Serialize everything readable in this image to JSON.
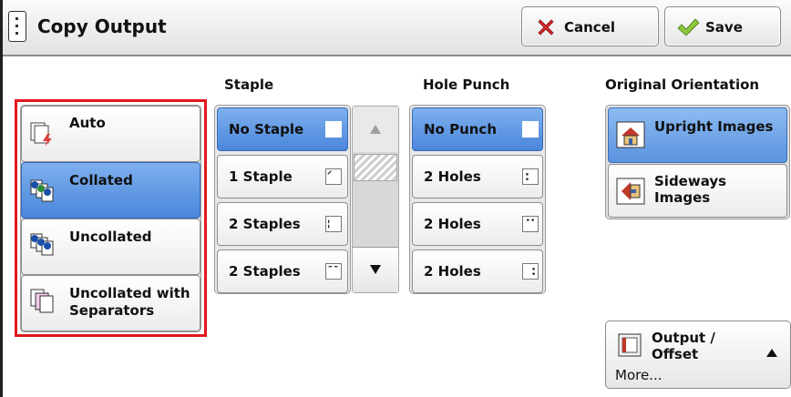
{
  "header": {
    "title": "Copy Output",
    "cancel_label": "Cancel",
    "save_label": "Save"
  },
  "collation": {
    "options": [
      {
        "label": "Auto",
        "selected": false
      },
      {
        "label": "Collated",
        "selected": true
      },
      {
        "label": "Uncollated",
        "selected": false
      },
      {
        "label": "Uncollated with Separators",
        "selected": false
      }
    ]
  },
  "staple": {
    "heading": "Staple",
    "options": [
      {
        "label": "No Staple",
        "selected": true
      },
      {
        "label": "1 Staple",
        "selected": false
      },
      {
        "label": "2 Staples",
        "selected": false
      },
      {
        "label": "2 Staples",
        "selected": false
      }
    ]
  },
  "hole_punch": {
    "heading": "Hole Punch",
    "options": [
      {
        "label": "No Punch",
        "selected": true
      },
      {
        "label": "2 Holes",
        "selected": false
      },
      {
        "label": "2 Holes",
        "selected": false
      },
      {
        "label": "2 Holes",
        "selected": false
      }
    ]
  },
  "orientation": {
    "heading": "Original Orientation",
    "options": [
      {
        "label": "Upright Images",
        "selected": true
      },
      {
        "label": "Sideways Images",
        "selected": false
      }
    ]
  },
  "output_offset": {
    "label": "Output / Offset",
    "more_label": "More..."
  },
  "colors": {
    "selected": "#4a86db",
    "highlight_border": "#e0191d",
    "cancel_icon": "#d6282d",
    "save_icon": "#8cc63f"
  }
}
